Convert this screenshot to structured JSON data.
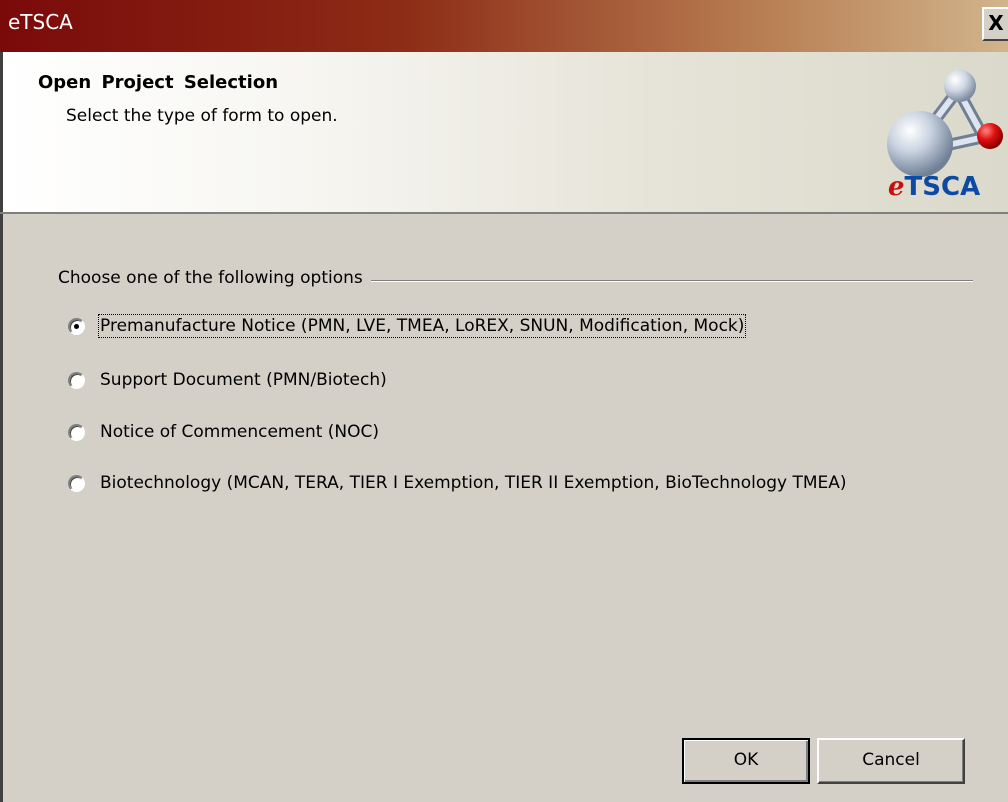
{
  "window": {
    "title": "eTSCA",
    "close_label": "X"
  },
  "header": {
    "title": "Open  Project  Selection",
    "subtitle": "Select the type of form to open.",
    "logo_text_prefix": "e",
    "logo_text": "TSCA"
  },
  "group": {
    "label": "Choose one of the following options"
  },
  "options": [
    {
      "label": "Premanufacture Notice (PMN, LVE, TMEA, LoREX, SNUN, Modification, Mock)",
      "checked": true
    },
    {
      "label": "Support Document (PMN/Biotech)",
      "checked": false
    },
    {
      "label": "Notice of Commencement (NOC)",
      "checked": false
    },
    {
      "label": "Biotechnology (MCAN, TERA, TIER I Exemption, TIER II Exemption, BioTechnology TMEA)",
      "checked": false
    }
  ],
  "buttons": {
    "ok": "OK",
    "cancel": "Cancel"
  }
}
